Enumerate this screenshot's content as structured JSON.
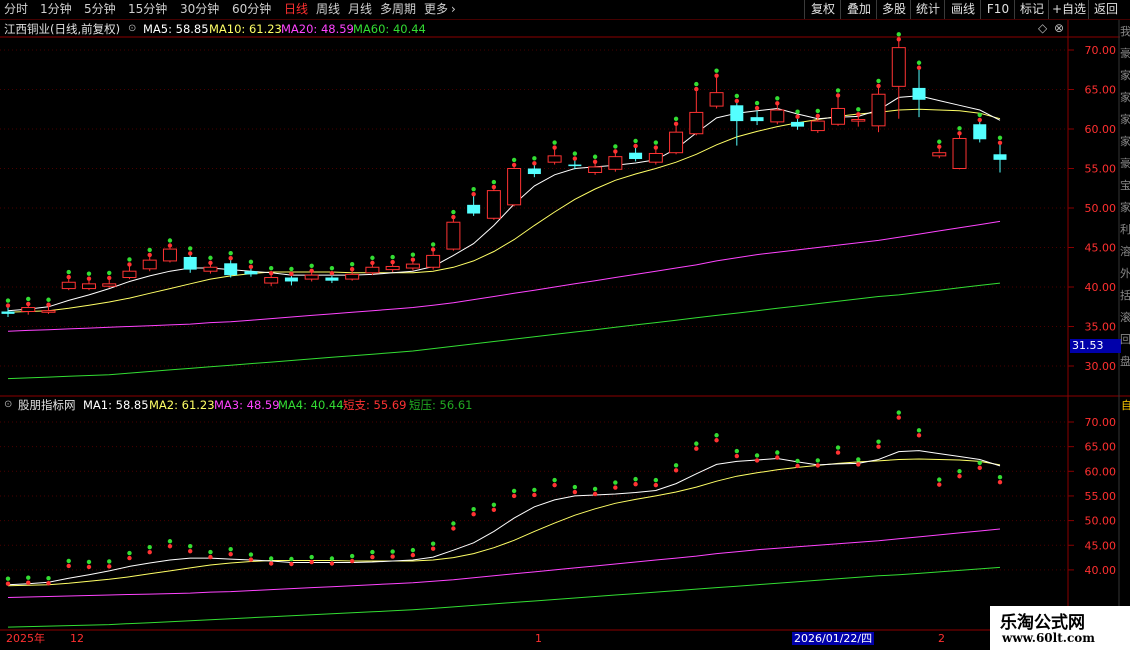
{
  "toolbar": {
    "periods": [
      "分时",
      "1分钟",
      "5分钟",
      "15分钟",
      "30分钟",
      "60分钟",
      "日线",
      "周线",
      "月线",
      "多周期",
      "更多"
    ],
    "active_period": "日线",
    "more_arrow": "›",
    "right_buttons": [
      "复权",
      "叠加",
      "多股",
      "统计",
      "画线",
      "F10",
      "标记",
      "+自选",
      "返回"
    ]
  },
  "main_panel": {
    "title": "江西铜业(日线,前复权)",
    "legend": [
      {
        "label": "MA5: 58.85",
        "color": "#ffffff"
      },
      {
        "label": "MA10: 61.23",
        "color": "#ffff66"
      },
      {
        "label": "MA20: 48.59",
        "color": "#ff44ff"
      },
      {
        "label": "MA60: 40.44",
        "color": "#33dd33"
      }
    ],
    "y_ticks": [
      "70.00",
      "65.00",
      "60.00",
      "55.00",
      "50.00",
      "45.00",
      "40.00",
      "35.00",
      "30.00"
    ],
    "current_price_tag": "31.53"
  },
  "sub_panel": {
    "title": "股朋指标网",
    "legend": [
      {
        "label": "MA1: 58.85",
        "color": "#ffffff"
      },
      {
        "label": "MA2: 61.23",
        "color": "#ffff66"
      },
      {
        "label": "MA3: 48.59",
        "color": "#ff44ff"
      },
      {
        "label": "MA4: 40.44",
        "color": "#33dd33"
      },
      {
        "label": "短支: 55.69",
        "color": "#ff3333"
      },
      {
        "label": "短压: 56.61",
        "color": "#22aa22"
      }
    ],
    "y_ticks": [
      "70.00",
      "65.00",
      "60.00",
      "55.00",
      "50.00",
      "45.00",
      "40.00"
    ]
  },
  "date_axis": {
    "labels": [
      "2025年",
      "12",
      "1",
      "2"
    ],
    "cursor_date": "2026/01/22/四"
  },
  "right_strip_text": [
    "我",
    "豪",
    "家",
    "家",
    "家",
    "家",
    "豪",
    "宝",
    "家",
    "利",
    "溶",
    "外",
    "括",
    "滚",
    "回",
    "盘"
  ],
  "watermark": {
    "title": "乐淘公式网",
    "url": "www.60lt.com"
  },
  "chart_data": {
    "type": "candlestick",
    "ylim": [
      27,
      72
    ],
    "candles": [
      {
        "o": 36.9,
        "c": 36.6,
        "h": 37.4,
        "l": 36.2
      },
      {
        "o": 36.9,
        "c": 37.4,
        "h": 37.6,
        "l": 36.5
      },
      {
        "o": 36.8,
        "c": 37.0,
        "h": 37.5,
        "l": 36.6
      },
      {
        "o": 39.8,
        "c": 40.6,
        "h": 41.0,
        "l": 39.6
      },
      {
        "o": 39.8,
        "c": 40.4,
        "h": 40.8,
        "l": 39.6
      },
      {
        "o": 40.1,
        "c": 40.4,
        "h": 40.9,
        "l": 39.9
      },
      {
        "o": 41.2,
        "c": 42.0,
        "h": 42.6,
        "l": 41.0
      },
      {
        "o": 42.3,
        "c": 43.4,
        "h": 43.8,
        "l": 42.0
      },
      {
        "o": 43.3,
        "c": 44.8,
        "h": 45.0,
        "l": 43.1
      },
      {
        "o": 43.8,
        "c": 42.2,
        "h": 44.0,
        "l": 41.8
      },
      {
        "o": 42.0,
        "c": 42.5,
        "h": 42.8,
        "l": 41.7
      },
      {
        "o": 43.0,
        "c": 41.5,
        "h": 43.4,
        "l": 41.2
      },
      {
        "o": 42.0,
        "c": 41.6,
        "h": 42.3,
        "l": 41.3
      },
      {
        "o": 40.5,
        "c": 41.2,
        "h": 41.5,
        "l": 40.1
      },
      {
        "o": 41.2,
        "c": 40.7,
        "h": 41.4,
        "l": 40.2
      },
      {
        "o": 41.0,
        "c": 41.5,
        "h": 41.8,
        "l": 40.7
      },
      {
        "o": 41.2,
        "c": 40.8,
        "h": 41.5,
        "l": 40.5
      },
      {
        "o": 41.0,
        "c": 41.6,
        "h": 42.0,
        "l": 40.8
      },
      {
        "o": 41.8,
        "c": 42.5,
        "h": 42.8,
        "l": 41.5
      },
      {
        "o": 42.2,
        "c": 42.6,
        "h": 42.9,
        "l": 41.9
      },
      {
        "o": 42.4,
        "c": 42.9,
        "h": 43.2,
        "l": 42.1
      },
      {
        "o": 42.5,
        "c": 44.0,
        "h": 44.5,
        "l": 42.2
      },
      {
        "o": 44.8,
        "c": 48.2,
        "h": 48.6,
        "l": 44.6
      },
      {
        "o": 50.4,
        "c": 49.3,
        "h": 51.5,
        "l": 49.0
      },
      {
        "o": 48.7,
        "c": 52.2,
        "h": 52.4,
        "l": 48.5
      },
      {
        "o": 50.4,
        "c": 55.0,
        "h": 55.2,
        "l": 50.2
      },
      {
        "o": 55.0,
        "c": 54.3,
        "h": 55.4,
        "l": 53.9
      },
      {
        "o": 55.8,
        "c": 56.6,
        "h": 57.4,
        "l": 55.5
      },
      {
        "o": 55.5,
        "c": 55.3,
        "h": 56.0,
        "l": 54.9
      },
      {
        "o": 54.5,
        "c": 55.2,
        "h": 55.6,
        "l": 54.2
      },
      {
        "o": 54.9,
        "c": 56.5,
        "h": 56.9,
        "l": 54.6
      },
      {
        "o": 57.0,
        "c": 56.2,
        "h": 57.6,
        "l": 55.9
      },
      {
        "o": 55.8,
        "c": 56.9,
        "h": 57.4,
        "l": 55.5
      },
      {
        "o": 57.0,
        "c": 59.6,
        "h": 60.4,
        "l": 56.8
      },
      {
        "o": 59.4,
        "c": 62.1,
        "h": 64.8,
        "l": 59.2
      },
      {
        "o": 62.9,
        "c": 64.6,
        "h": 66.5,
        "l": 62.6
      },
      {
        "o": 63.0,
        "c": 61.0,
        "h": 63.3,
        "l": 57.9
      },
      {
        "o": 61.5,
        "c": 61.0,
        "h": 62.4,
        "l": 60.5
      },
      {
        "o": 60.9,
        "c": 62.4,
        "h": 63.0,
        "l": 60.6
      },
      {
        "o": 60.9,
        "c": 60.3,
        "h": 61.3,
        "l": 59.9
      },
      {
        "o": 59.8,
        "c": 61.0,
        "h": 61.4,
        "l": 59.5
      },
      {
        "o": 60.6,
        "c": 62.6,
        "h": 64.0,
        "l": 60.4
      },
      {
        "o": 61.0,
        "c": 61.2,
        "h": 61.6,
        "l": 60.3
      },
      {
        "o": 60.4,
        "c": 64.4,
        "h": 65.2,
        "l": 59.6
      },
      {
        "o": 65.4,
        "c": 70.3,
        "h": 71.1,
        "l": 61.3
      },
      {
        "o": 65.2,
        "c": 63.7,
        "h": 67.5,
        "l": 61.5
      },
      {
        "o": 56.6,
        "c": 57.0,
        "h": 57.5,
        "l": 56.3
      },
      {
        "o": 55.0,
        "c": 58.8,
        "h": 59.2,
        "l": 54.9
      },
      {
        "o": 60.6,
        "c": 58.7,
        "h": 60.9,
        "l": 58.3
      },
      {
        "o": 56.8,
        "c": 56.1,
        "h": 58.0,
        "l": 54.5
      }
    ],
    "ma5": [
      37.0,
      37.2,
      37.5,
      38.3,
      39.0,
      39.8,
      40.7,
      41.4,
      42.0,
      42.4,
      42.4,
      42.2,
      42.0,
      41.8,
      41.5,
      41.5,
      41.5,
      41.5,
      41.6,
      41.8,
      42.0,
      42.6,
      44.0,
      45.5,
      47.8,
      50.5,
      52.8,
      54.2,
      55.0,
      55.2,
      55.4,
      55.7,
      56.1,
      57.5,
      59.5,
      61.4,
      62.0,
      62.3,
      62.6,
      61.9,
      61.3,
      61.5,
      61.6,
      62.4,
      64.0,
      64.2,
      63.6,
      63.0,
      62.4,
      61.1
    ],
    "ma10": [
      36.8,
      36.9,
      37.0,
      37.3,
      37.7,
      38.1,
      38.6,
      39.2,
      39.8,
      40.4,
      41.0,
      41.4,
      41.7,
      41.9,
      41.9,
      41.9,
      41.9,
      41.8,
      41.8,
      41.8,
      41.8,
      42.0,
      42.5,
      43.3,
      44.5,
      46.0,
      47.8,
      49.5,
      51.1,
      52.4,
      53.5,
      54.3,
      55.0,
      55.8,
      56.8,
      58.0,
      59.0,
      59.7,
      60.3,
      60.8,
      61.2,
      61.6,
      61.9,
      62.1,
      62.4,
      62.5,
      62.4,
      62.3,
      62.0,
      61.3
    ],
    "ma20": [
      34.4,
      34.5,
      34.6,
      34.7,
      34.8,
      34.9,
      35.0,
      35.1,
      35.2,
      35.3,
      35.5,
      35.6,
      35.8,
      36.0,
      36.2,
      36.4,
      36.6,
      36.8,
      37.0,
      37.2,
      37.4,
      37.7,
      38.0,
      38.4,
      38.8,
      39.2,
      39.6,
      40.0,
      40.4,
      40.8,
      41.2,
      41.6,
      42.0,
      42.4,
      42.8,
      43.3,
      43.7,
      44.1,
      44.4,
      44.7,
      45.0,
      45.3,
      45.6,
      45.9,
      46.3,
      46.7,
      47.1,
      47.5,
      47.9,
      48.3
    ],
    "ma60": [
      28.4,
      28.5,
      28.6,
      28.7,
      28.8,
      28.9,
      29.1,
      29.3,
      29.5,
      29.7,
      29.9,
      30.1,
      30.3,
      30.5,
      30.7,
      30.9,
      31.1,
      31.3,
      31.5,
      31.7,
      31.9,
      32.2,
      32.5,
      32.8,
      33.1,
      33.4,
      33.7,
      34.0,
      34.3,
      34.6,
      34.9,
      35.2,
      35.5,
      35.8,
      36.1,
      36.4,
      36.7,
      37.0,
      37.3,
      37.6,
      37.9,
      38.2,
      38.5,
      38.8,
      39.0,
      39.3,
      39.6,
      39.9,
      40.2,
      40.5
    ]
  }
}
